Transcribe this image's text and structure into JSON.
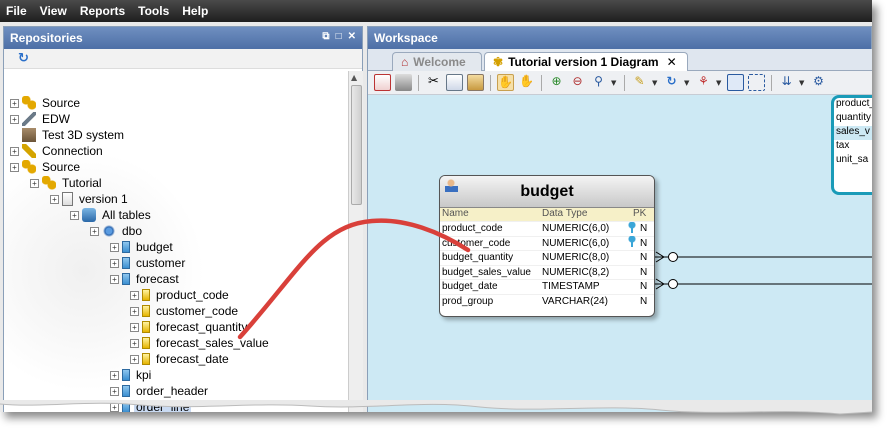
{
  "menu": [
    "File",
    "View",
    "Reports",
    "Tools",
    "Help"
  ],
  "repositories": {
    "title": "Repositories",
    "tree": [
      {
        "label": "Source",
        "icon": "source-icon",
        "depth": 0
      },
      {
        "label": "EDW",
        "icon": "edw-icon",
        "depth": 0
      },
      {
        "label": "Test 3D system",
        "icon": "building-icon",
        "depth": 0
      },
      {
        "label": "Connection",
        "icon": "connection-icon",
        "depth": 0
      },
      {
        "label": "Source",
        "icon": "source-icon",
        "depth": 0
      },
      {
        "label": "Tutorial",
        "icon": "source-icon",
        "depth": 1
      },
      {
        "label": "version 1",
        "icon": "version-icon",
        "depth": 2
      },
      {
        "label": "All tables",
        "icon": "database-icon",
        "depth": 3
      },
      {
        "label": "dbo",
        "icon": "gear-icon",
        "depth": 4
      },
      {
        "label": "budget",
        "icon": "table-icon",
        "depth": 5
      },
      {
        "label": "customer",
        "icon": "table-icon",
        "depth": 5
      },
      {
        "label": "forecast",
        "icon": "table-icon",
        "depth": 5
      },
      {
        "label": "product_code",
        "icon": "column-icon",
        "depth": 6
      },
      {
        "label": "customer_code",
        "icon": "column-icon",
        "depth": 6
      },
      {
        "label": "forecast_quantity",
        "icon": "column-icon",
        "depth": 6
      },
      {
        "label": "forecast_sales_value",
        "icon": "column-icon",
        "depth": 6
      },
      {
        "label": "forecast_date",
        "icon": "column-icon",
        "depth": 6
      },
      {
        "label": "kpi",
        "icon": "table-icon",
        "depth": 5
      },
      {
        "label": "order_header",
        "icon": "table-icon",
        "depth": 5
      },
      {
        "label": "order_line",
        "icon": "table-icon",
        "depth": 5,
        "selected": true
      }
    ]
  },
  "workspace": {
    "title": "Workspace",
    "tabs": [
      {
        "label": "Welcome",
        "active": false
      },
      {
        "label": "Tutorial version 1 Diagram",
        "active": true
      }
    ]
  },
  "entity": {
    "title": "budget",
    "columns": {
      "name": "Name",
      "type": "Data Type",
      "pk": "PK"
    },
    "rows": [
      {
        "name": "product_code",
        "type": "NUMERIC(6,0)",
        "pk": true,
        "nn": "N"
      },
      {
        "name": "customer_code",
        "type": "NUMERIC(6,0)",
        "pk": true,
        "nn": "N"
      },
      {
        "name": "budget_quantity",
        "type": "NUMERIC(8,0)",
        "pk": false,
        "nn": "N"
      },
      {
        "name": "budget_sales_value",
        "type": "NUMERIC(8,2)",
        "pk": false,
        "nn": "N"
      },
      {
        "name": "budget_date",
        "type": "TIMESTAMP",
        "pk": false,
        "nn": "N"
      },
      {
        "name": "prod_group",
        "type": "VARCHAR(24)",
        "pk": false,
        "nn": "N"
      }
    ]
  },
  "partial_entity": {
    "rows": [
      "product_",
      "quantity",
      "sales_v",
      "tax",
      "unit_sa"
    ]
  },
  "colors": {
    "arrow": "#d9403a",
    "panel_header": "#5a7db5",
    "canvas": "#cde9f4",
    "partial_border": "#1a9bb8"
  }
}
